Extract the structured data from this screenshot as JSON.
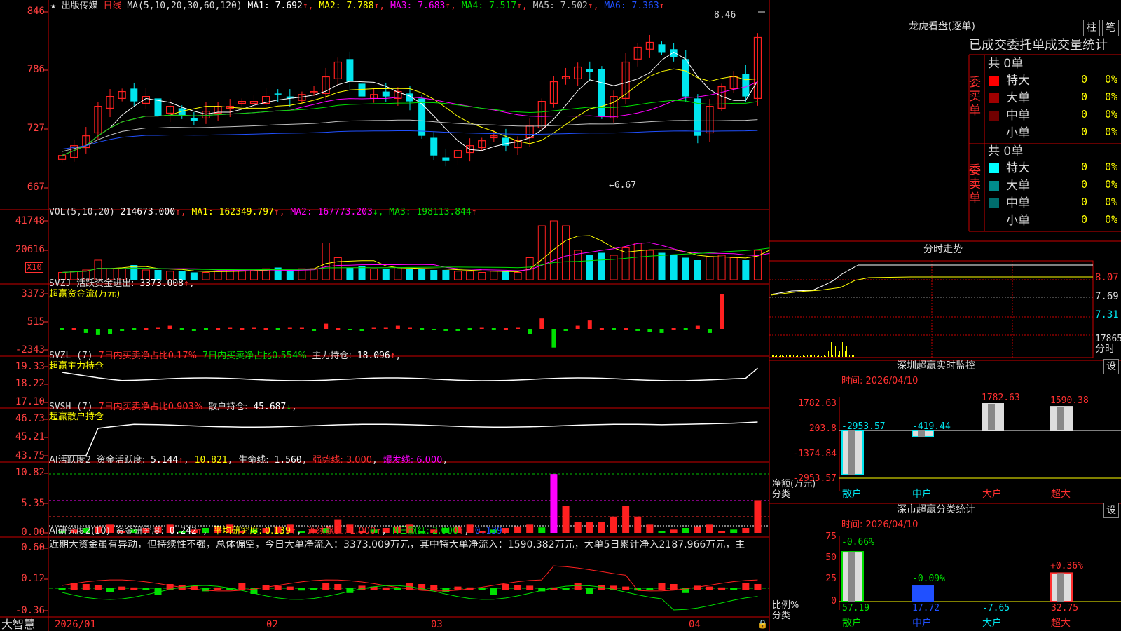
{
  "colors": {
    "up": "#ff2020",
    "down": "#00e5ee",
    "grid": "#8b0000",
    "axis": "#ff3030",
    "white": "#ffffff",
    "yellow": "#ffff00",
    "magenta": "#ff00ff",
    "green": "#00e000",
    "blue": "#2050ff"
  },
  "price_panel": {
    "star": "★",
    "arrow": "↑",
    "stock_name": "出版传媒",
    "period": "日线",
    "ma_title": "MA(5,10,20,30,60,120)",
    "ma": [
      {
        "label": "MA1:",
        "value": "7.692",
        "color": "#ffffff"
      },
      {
        "label": "MA2:",
        "value": "7.788",
        "color": "#ffff00"
      },
      {
        "label": "MA3:",
        "value": "7.683",
        "color": "#ff00ff"
      },
      {
        "label": "MA4:",
        "value": "7.517",
        "color": "#00e000"
      },
      {
        "label": "MA5:",
        "value": "7.502",
        "color": "#c0c0c0"
      },
      {
        "label": "MA6:",
        "value": "7.363",
        "color": "#2050ff"
      }
    ],
    "y_ticks": [
      "846",
      "786",
      "727",
      "667"
    ],
    "high_note": "8.46",
    "low_note": "←6.67"
  },
  "vol_panel": {
    "title": "VOL(5,10,20)",
    "value": "214673.000",
    "ma": [
      {
        "label": "MA1:",
        "value": "162349.797",
        "arrow": "↑",
        "color": "#ffff00"
      },
      {
        "label": "MA2:",
        "value": "167773.203",
        "arrow": "↓",
        "color": "#ff00ff"
      },
      {
        "label": "MA3:",
        "value": "198113.844",
        "arrow": "↑",
        "color": "#00e000"
      }
    ],
    "y_ticks": [
      "41748",
      "20616"
    ],
    "unit": "X10"
  },
  "svzj_panel": {
    "title": "SVZJ",
    "label": "活跃资金进出:",
    "value": "3373.008",
    "subtitle": "超赢资金流(万元)",
    "y_ticks": [
      "3373",
      "515",
      "-2343"
    ]
  },
  "svzl_panel": {
    "title": "SVZL (7)",
    "t1": "7日内买卖净占比0.17%",
    "t2": "7日内买卖净占比0.554%",
    "label": "主力持仓:",
    "value": "18.096",
    "subtitle": "超赢主力持仓",
    "y_ticks": [
      "19.33",
      "18.22",
      "17.10"
    ]
  },
  "svsh_panel": {
    "title": "SVSH (7)",
    "t1": "7日内买卖净占比0.903%",
    "label": "散户持仓:",
    "value": "45.687",
    "subtitle": "超赢散户持仓",
    "y_ticks": [
      "46.73",
      "45.21",
      "43.75"
    ]
  },
  "ai_panel": {
    "title": "AI活跃度2",
    "label": "资金活跃度:",
    "value": "5.144",
    "v2": "10.821",
    "life_label": "生命线:",
    "life_value": "1.560",
    "strong": "强势线: 3.000",
    "burst": "爆发线: 6.000",
    "y_ticks": [
      "10.82",
      "5.35",
      "0.00"
    ]
  },
  "research_panel": {
    "title": "AI研究度2(10)",
    "label": "资金研究度:",
    "value": "0.242",
    "avg": "平均研究度: 0.139",
    "cont": "连续飘红: 1.000",
    "nday": "N日飘红: 2.000",
    "last": "0.139",
    "comment": "近期大资金虽有异动，但持续性不强，总体偏空，今日大单净流入：3373.009万元，其中特大单净流入：1590.382万元，大单5日累计净入2187.966万元，主",
    "y_ticks": [
      "0.60",
      "0.12",
      "-0.36"
    ]
  },
  "date_axis": {
    "brand": "大智慧",
    "labels": [
      "2026/01",
      "02",
      "03",
      "04"
    ]
  },
  "dragon": {
    "title": "龙虎看盘(逐单)",
    "btn1": "柱",
    "btn2": "笔",
    "header": "已成交委托单成交量统计",
    "buy_side": "委买单",
    "sell_side": "委卖单",
    "buy_total": "共 0单",
    "sell_total": "共 0单",
    "buy_rows": [
      {
        "name": "特大",
        "count": "0",
        "pct": "0%",
        "color": "#ff0000"
      },
      {
        "name": "大单",
        "count": "0",
        "pct": "0%",
        "color": "#a00000"
      },
      {
        "name": "中单",
        "count": "0",
        "pct": "0%",
        "color": "#700000"
      },
      {
        "name": "小单",
        "count": "0",
        "pct": "0%",
        "color": "#000000"
      }
    ],
    "sell_rows": [
      {
        "name": "特大",
        "count": "0",
        "pct": "0%",
        "color": "#00ffff"
      },
      {
        "name": "大单",
        "count": "0",
        "pct": "0%",
        "color": "#008b8b"
      },
      {
        "name": "中单",
        "count": "0",
        "pct": "0%",
        "color": "#006d6d"
      },
      {
        "name": "小单",
        "count": "0",
        "pct": "0%",
        "color": "#000000"
      }
    ]
  },
  "intraday": {
    "title": "分时走势",
    "ticks": [
      "8.07",
      "7.69",
      "7.31",
      "17865"
    ],
    "tick_label": "分时"
  },
  "sz_monitor": {
    "title": "深圳超赢实时监控",
    "btn": "设",
    "date": "时间: 2026/04/10",
    "y_ticks": [
      "1782.63",
      "203.8",
      "-1374.84",
      "-2953.57"
    ],
    "unit_label": "净额(万元)",
    "cat_label": "分类",
    "cats": [
      "散户",
      "中户",
      "大户",
      "超大"
    ],
    "values": [
      -2953.57,
      -419.44,
      1782.63,
      1590.38
    ],
    "value_labels": [
      "-2953.57",
      "-419.44",
      "1782.63",
      "1590.38"
    ]
  },
  "sz_category": {
    "title": "深市超赢分类统计",
    "btn": "设",
    "date": "时间: 2026/04/10",
    "y_ticks": [
      "75",
      "50",
      "25",
      "0"
    ],
    "ratio_label": "比例%",
    "cat_label": "分类",
    "cats": [
      "散户",
      "中户",
      "大户",
      "超大"
    ],
    "values": [
      57.19,
      17.72,
      -7.65,
      32.75
    ],
    "value_labels": [
      "57.19",
      "17.72",
      "-7.65",
      "32.75"
    ],
    "change_labels": [
      "-0.66%",
      "-0.09%",
      "",
      "+0.36%"
    ]
  },
  "chart_data": {
    "type": "candlestick",
    "title": "出版传媒 日线",
    "y_range": [
      6.67,
      8.46
    ],
    "x_labels": [
      "2026/01",
      "02",
      "03",
      "04"
    ],
    "close_approx": [
      7.0,
      7.1,
      7.2,
      7.5,
      7.6,
      7.65,
      7.55,
      7.6,
      7.4,
      7.5,
      7.4,
      7.35,
      7.45,
      7.5,
      7.5,
      7.55,
      7.55,
      7.6,
      7.62,
      7.58,
      7.62,
      7.65,
      7.8,
      7.95,
      7.75,
      7.6,
      7.62,
      7.6,
      7.65,
      7.55,
      7.2,
      7.0,
      6.95,
      7.05,
      7.1,
      7.15,
      7.2,
      7.1,
      7.15,
      7.3,
      7.55,
      7.75,
      7.8,
      7.9,
      7.85,
      7.4,
      7.6,
      7.95,
      8.1,
      8.15,
      8.05,
      8.0,
      7.6,
      7.2,
      7.5,
      7.7,
      7.8,
      7.6,
      8.2
    ],
    "volume_approx_x10": [
      3000,
      3500,
      4000,
      8000,
      4500,
      4500,
      6000,
      4000,
      4000,
      3500,
      3500,
      3000,
      3000,
      3500,
      4000,
      4000,
      4000,
      4500,
      5000,
      4000,
      4500,
      4500,
      15000,
      9000,
      5000,
      5500,
      4500,
      4500,
      5000,
      4500,
      4500,
      4000,
      4000,
      3500,
      3500,
      3000,
      3500,
      3500,
      3000,
      9000,
      22000,
      24000,
      22000,
      12000,
      10000,
      11000,
      10000,
      13000,
      15000,
      12000,
      11000,
      10000,
      9000,
      8000,
      9500,
      10000,
      9000,
      8000,
      12000,
      21467
    ],
    "svzj_values": [
      0,
      0,
      -400,
      -600,
      -500,
      -200,
      0,
      0,
      100,
      300,
      0,
      -200,
      0,
      0,
      100,
      0,
      100,
      0,
      0,
      100,
      100,
      -200,
      500,
      0,
      -100,
      -200,
      100,
      100,
      300,
      100,
      0,
      -100,
      -200,
      -200,
      0,
      100,
      0,
      0,
      100,
      -500,
      1000,
      -1800,
      -200,
      300,
      800,
      0,
      0,
      0,
      -200,
      -300,
      -400,
      0,
      0,
      300,
      -400,
      3373
    ]
  }
}
